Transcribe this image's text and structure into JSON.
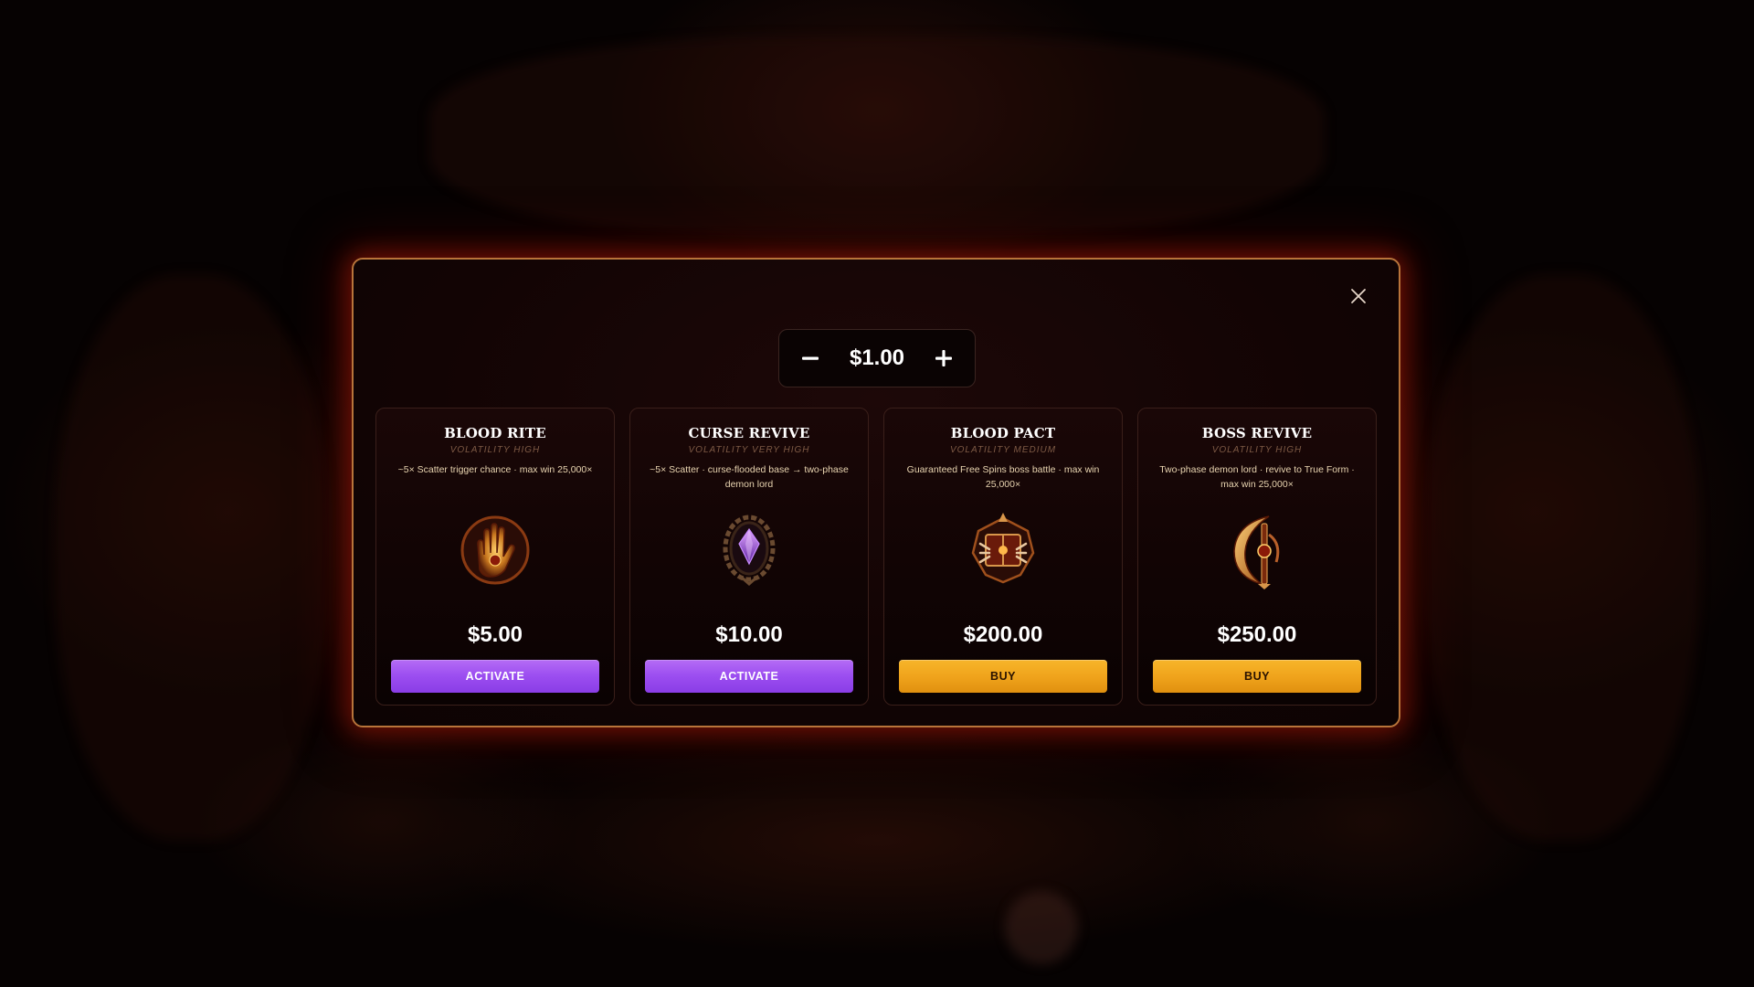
{
  "modal": {
    "close_icon": "close-icon",
    "stepper": {
      "value": "$1.00",
      "decrement_icon": "minus-icon",
      "increment_icon": "plus-icon"
    },
    "cards": [
      {
        "title": "BLOOD RITE",
        "volatility": "VOLATILITY HIGH",
        "description": "~5× Scatter trigger chance · max win 25,000×",
        "icon": "blood-hand-icon",
        "price": "$5.00",
        "button_label": "ACTIVATE",
        "button_color": "#9b4df0"
      },
      {
        "title": "CURSE REVIVE",
        "volatility": "VOLATILITY VERY HIGH",
        "description": "~5× Scatter · curse-flooded base → two-phase demon lord",
        "icon": "cursed-gem-icon",
        "price": "$10.00",
        "button_label": "ACTIVATE",
        "button_color": "#9b4df0"
      },
      {
        "title": "BLOOD PACT",
        "volatility": "VOLATILITY MEDIUM",
        "description": "Guaranteed Free Spins boss battle · max win 25,000×",
        "icon": "demon-book-icon",
        "price": "$200.00",
        "button_label": "BUY",
        "button_color": "#f0a41c"
      },
      {
        "title": "BOSS REVIVE",
        "volatility": "VOLATILITY HIGH",
        "description": "Two-phase demon lord · revive to True Form · max win 25,000×",
        "icon": "crescent-blade-icon",
        "price": "$250.00",
        "button_label": "BUY",
        "button_color": "#f0a41c"
      }
    ]
  }
}
